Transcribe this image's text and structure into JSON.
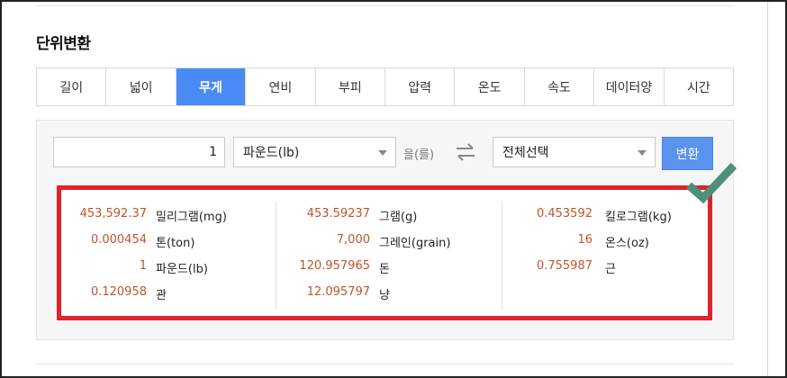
{
  "title": "단위변환",
  "tabs": [
    {
      "label": "길이",
      "active": false
    },
    {
      "label": "넓이",
      "active": false
    },
    {
      "label": "무게",
      "active": true
    },
    {
      "label": "연비",
      "active": false
    },
    {
      "label": "부피",
      "active": false
    },
    {
      "label": "압력",
      "active": false
    },
    {
      "label": "온도",
      "active": false
    },
    {
      "label": "속도",
      "active": false
    },
    {
      "label": "데이터양",
      "active": false
    },
    {
      "label": "시간",
      "active": false
    }
  ],
  "converter": {
    "input_value": "1",
    "from_unit": "파운드(lb)",
    "connector": "을(를)",
    "to_unit": "전체선택",
    "convert_label": "변환"
  },
  "results": {
    "col1": [
      {
        "value": "453,592.37",
        "unit": "밀리그램(mg)"
      },
      {
        "value": "0.000454",
        "unit": "톤(ton)"
      },
      {
        "value": "1",
        "unit": "파운드(lb)"
      },
      {
        "value": "0.120958",
        "unit": "관"
      }
    ],
    "col2": [
      {
        "value": "453.59237",
        "unit": "그램(g)"
      },
      {
        "value": "7,000",
        "unit": "그레인(grain)"
      },
      {
        "value": "120.957965",
        "unit": "돈"
      },
      {
        "value": "12.095797",
        "unit": "냥"
      }
    ],
    "col3": [
      {
        "value": "0.453592",
        "unit": "킬로그램(kg)"
      },
      {
        "value": "16",
        "unit": "온스(oz)"
      },
      {
        "value": "0.755987",
        "unit": "근"
      }
    ]
  },
  "colors": {
    "accent": "#4a8af4",
    "value_text": "#c0542a",
    "highlight_border": "#e0222a",
    "check_mark": "#4f8f7c"
  }
}
